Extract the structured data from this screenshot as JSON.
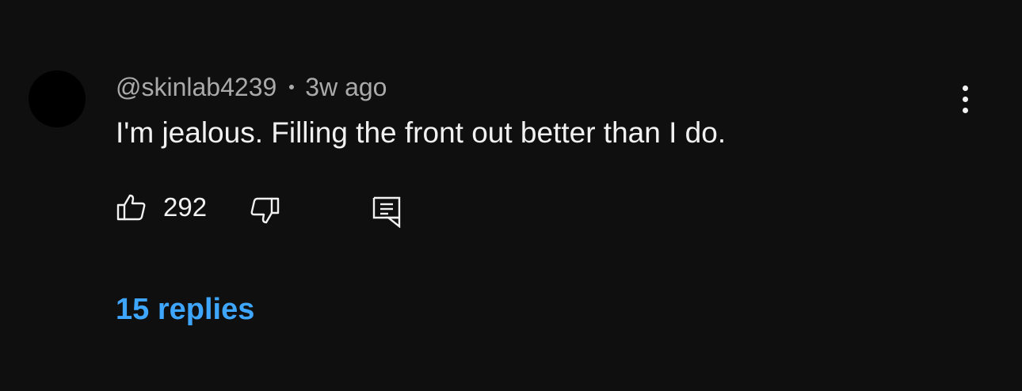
{
  "comment": {
    "author": "@skinlab4239",
    "time_ago": "3w ago",
    "text": "I'm jealous. Filling the front out better than I do.",
    "like_count": "292",
    "replies_label": "15 replies"
  },
  "icons": {
    "like": "thumbs-up-icon",
    "dislike": "thumbs-down-icon",
    "reply": "comment-reply-icon",
    "more": "more-vertical-icon"
  },
  "colors": {
    "background": "#0f0f0f",
    "text_primary": "#f1f1f1",
    "text_secondary": "#aaaaaa",
    "link": "#3ea6ff"
  }
}
